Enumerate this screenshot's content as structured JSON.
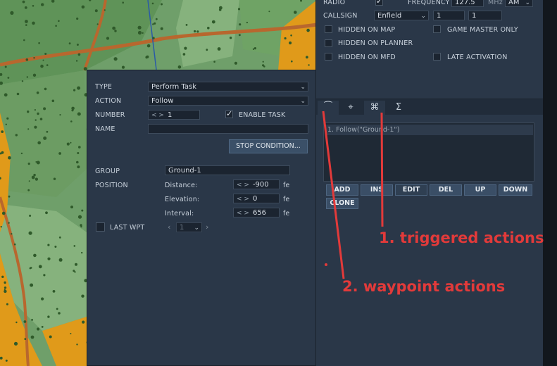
{
  "top_panel": {
    "radio_label": "RADIO",
    "frequency_label": "FREQUENCY",
    "frequency_value": "127.5",
    "frequency_unit": "MHz",
    "modulation": "AM",
    "callsign_label": "CALLSIGN",
    "callsign_value": "Enfield",
    "callsign_num1": "1",
    "callsign_num2": "1",
    "hidden_on_map": "HIDDEN ON MAP",
    "game_master_only": "GAME MASTER ONLY",
    "hidden_on_planner": "HIDDEN ON PLANNER",
    "hidden_on_mfd": "HIDDEN ON MFD",
    "late_activation": "LATE ACTIVATION"
  },
  "task": {
    "type_label": "TYPE",
    "type_value": "Perform Task",
    "action_label": "ACTION",
    "action_value": "Follow",
    "number_label": "NUMBER",
    "number_value": "1",
    "enable_task": "ENABLE TASK",
    "name_label": "NAME",
    "name_value": "",
    "stop_condition": "STOP CONDITION...",
    "group_label": "GROUP",
    "group_value": "Ground-1",
    "position_label": "POSITION",
    "distance_label": "Distance:",
    "distance_value": "-900",
    "elevation_label": "Elevation:",
    "elevation_value": "0",
    "interval_label": "Interval:",
    "interval_value": "656",
    "unit": "fe",
    "last_wpt": "LAST WPT",
    "last_wpt_value": "1"
  },
  "actions": {
    "tabs": [
      "⁀",
      "⌘",
      "⌘",
      "Σ"
    ],
    "list_item": "1. Follow(\"Ground-1\")",
    "buttons": [
      "ADD",
      "INS",
      "EDIT",
      "DEL",
      "UP",
      "DOWN"
    ],
    "clone": "CLONE"
  },
  "annotations": {
    "triggered": "1. triggered actions",
    "waypoint": "2. waypoint actions"
  },
  "colors": {
    "annotation": "#e23a3a",
    "panel": "#2a3748",
    "map_green": "#6f9f6a",
    "map_orange": "#e09a1a"
  }
}
